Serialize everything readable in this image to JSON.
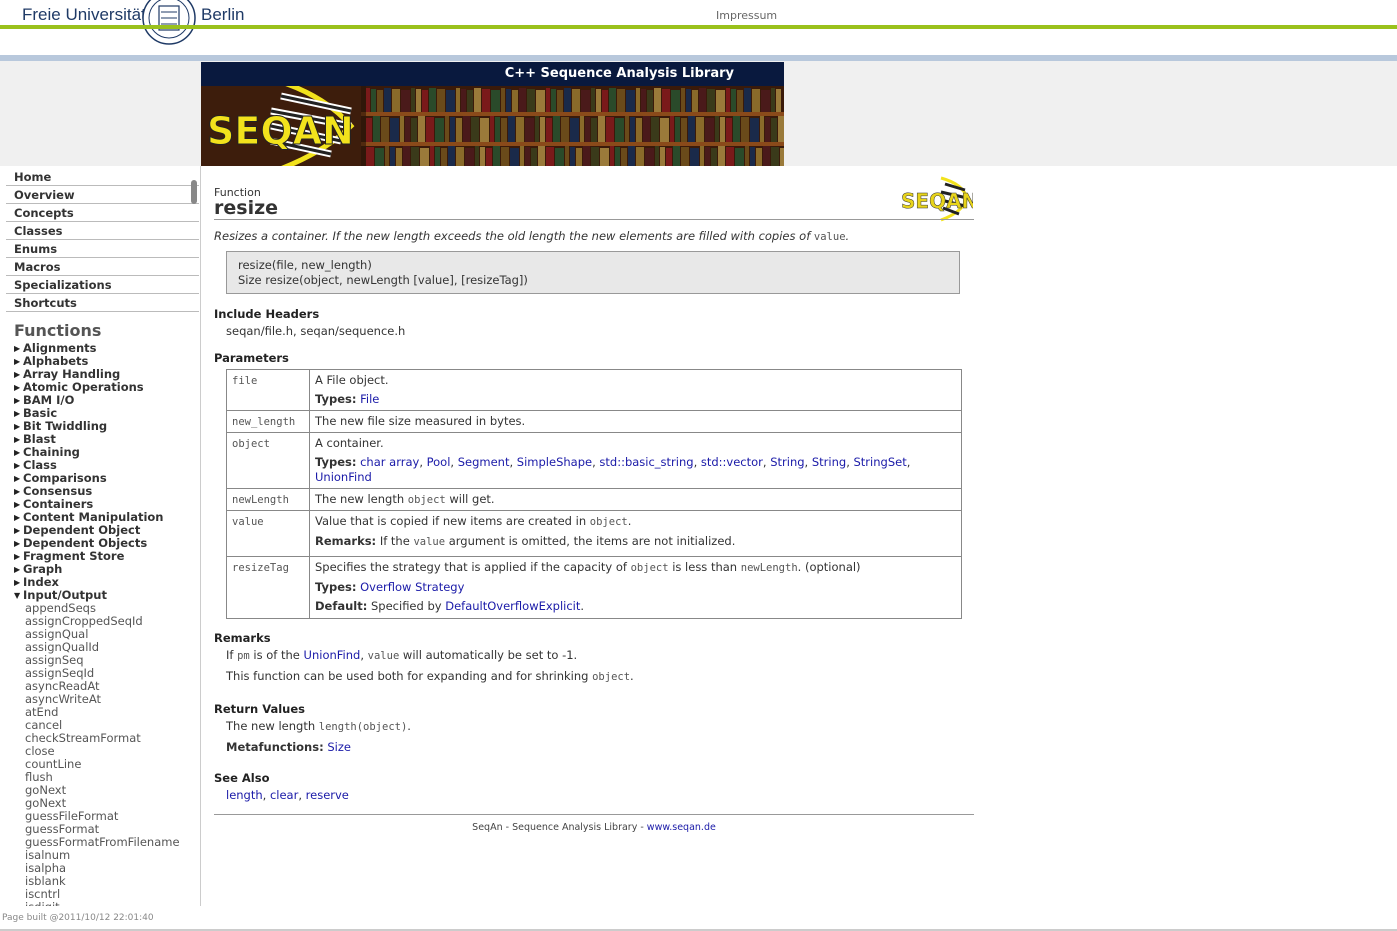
{
  "header": {
    "uni_left": "Freie Universität",
    "uni_right": "Berlin",
    "impressum": "Impressum"
  },
  "banner": {
    "title": "C++ Sequence Analysis Library",
    "logo_text": "SEQAN"
  },
  "sidebar": {
    "nav": [
      "Home",
      "Overview",
      "Concepts",
      "Classes",
      "Enums",
      "Macros",
      "Specializations",
      "Shortcuts"
    ],
    "functions_heading": "Functions",
    "categories": [
      "Alignments",
      "Alphabets",
      "Array Handling",
      "Atomic Operations",
      "BAM I/O",
      "Basic",
      "Bit Twiddling",
      "Blast",
      "Chaining",
      "Class",
      "Comparisons",
      "Consensus",
      "Containers",
      "Content Manipulation",
      "Dependent Object",
      "Dependent Objects",
      "Fragment Store",
      "Graph",
      "Index"
    ],
    "expanded_category": "Input/Output",
    "expanded_items": [
      "appendSeqs",
      "assignCroppedSeqId",
      "assignQual",
      "assignQualId",
      "assignSeq",
      "assignSeqId",
      "asyncReadAt",
      "asyncWriteAt",
      "atEnd",
      "cancel",
      "checkStreamFormat",
      "close",
      "countLine",
      "flush",
      "goNext",
      "goNext",
      "guessFileFormat",
      "guessFormat",
      "guessFormatFromFilename",
      "isalnum",
      "isalpha",
      "isblank",
      "iscntrl",
      "isdigit"
    ]
  },
  "page_built": "Page built @2011/10/12 22:01:40",
  "main": {
    "kind": "Function",
    "name": "resize",
    "summary_prefix": "Resizes a container. If the new length exceeds the old length the new elements are filled with copies of ",
    "summary_code": "value",
    "summary_suffix": ".",
    "signature_1": "resize(file, new_length)",
    "signature_2": "Size resize(object, newLength [value], [resizeTag])",
    "include_heading": "Include Headers",
    "include_value": "seqan/file.h, seqan/sequence.h",
    "params_heading": "Parameters",
    "params": {
      "file": {
        "name": "file",
        "desc": "A File object.",
        "types_label": "Types:",
        "types": "File"
      },
      "new_length": {
        "name": "new_length",
        "desc": "The new file size measured in bytes."
      },
      "object": {
        "name": "object",
        "desc": "A container.",
        "types_label": "Types:",
        "types": [
          "char array",
          "Pool",
          "Segment",
          "SimpleShape",
          "std::basic_string",
          "std::vector",
          "String",
          "String",
          "StringSet",
          "UnionFind"
        ]
      },
      "newLength": {
        "name": "newLength",
        "desc_prefix": "The new length ",
        "desc_code": "object",
        "desc_suffix": " will get."
      },
      "value": {
        "name": "value",
        "desc_prefix": "Value that is copied if new items are created in ",
        "desc_code": "object",
        "desc_suffix": ".",
        "remarks_label": "Remarks:",
        "remarks_prefix": " If the ",
        "remarks_code": "value",
        "remarks_suffix": " argument is omitted, the items are not initialized."
      },
      "resizeTag": {
        "name": "resizeTag",
        "desc_prefix": "Specifies the strategy that is applied if the capacity of ",
        "desc_code1": "object",
        "desc_mid": " is less than ",
        "desc_code2": "newLength",
        "desc_suffix": ". (optional)",
        "types_label": "Types:",
        "types": "Overflow Strategy",
        "default_label": "Default:",
        "default_prefix": " Specified by ",
        "default_link": "DefaultOverflowExplicit",
        "default_suffix": "."
      }
    },
    "remarks_heading": "Remarks",
    "remarks_1": {
      "prefix": "If ",
      "code1": "pm",
      "mid1": " is of the ",
      "link": "UnionFind",
      "mid2": ", ",
      "code2": "value",
      "suffix": " will automatically be set to -1."
    },
    "remarks_2": {
      "prefix": "This function can be used both for expanding and for shrinking ",
      "code": "object",
      "suffix": "."
    },
    "returns_heading": "Return Values",
    "returns": {
      "prefix": "The new length ",
      "code": "length(object)",
      "suffix": "."
    },
    "metafunctions_label": "Metafunctions:",
    "metafunctions": "Size",
    "seealso_heading": "See Also",
    "seealso": [
      "length",
      "clear",
      "reserve"
    ],
    "footer_text": "SeqAn - Sequence Analysis Library - ",
    "footer_link": "www.seqan.de"
  }
}
